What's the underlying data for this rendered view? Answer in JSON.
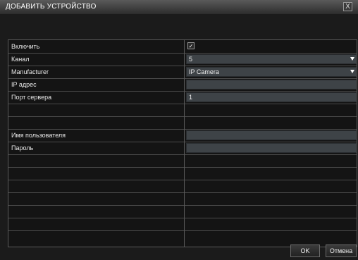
{
  "window": {
    "title": "ДОБАВИТЬ УСТРОЙСТВО",
    "close_label": "X"
  },
  "form": {
    "enable": {
      "label": "Включить",
      "checked": true,
      "check_glyph": "✓"
    },
    "channel": {
      "label": "Канал",
      "value": "5"
    },
    "manufacturer": {
      "label": "Manufacturer",
      "value": "IP Camera"
    },
    "ip": {
      "label": "IP адрес",
      "value": ""
    },
    "port": {
      "label": "Порт сервера",
      "value": "1"
    },
    "username": {
      "label": "Имя пользователя",
      "value": ""
    },
    "password": {
      "label": "Пароль",
      "value": ""
    }
  },
  "buttons": {
    "ok": "OK",
    "cancel": "Отмена"
  }
}
